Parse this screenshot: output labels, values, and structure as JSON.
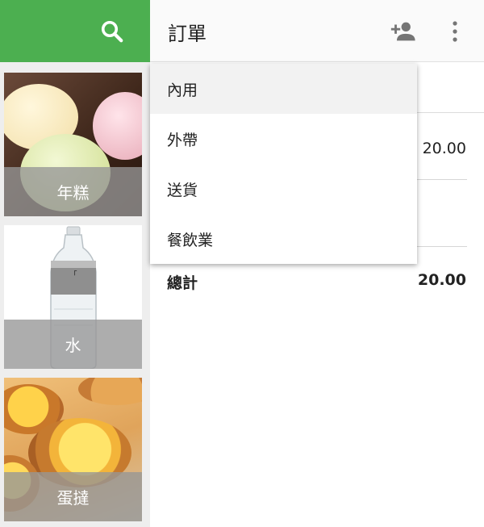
{
  "app": {
    "title": "訂單"
  },
  "toolbar": {
    "search_icon": "search-icon",
    "add_customer_icon": "add-person-icon",
    "more_icon": "more-vert-icon"
  },
  "products": [
    {
      "label": "年糕",
      "image": "mochi"
    },
    {
      "label": "水",
      "image": "water-bottle"
    },
    {
      "label": "蛋撻",
      "image": "egg-tart"
    }
  ],
  "order_type_menu": {
    "selected_index": 0,
    "options": [
      "內用",
      "外帶",
      "送貨",
      "餐飲業"
    ]
  },
  "order": {
    "line_price": "20.00",
    "total_label": "總計",
    "total_value": "20.00"
  },
  "colors": {
    "accent": "#4caf50",
    "icon_gray": "#757575"
  }
}
